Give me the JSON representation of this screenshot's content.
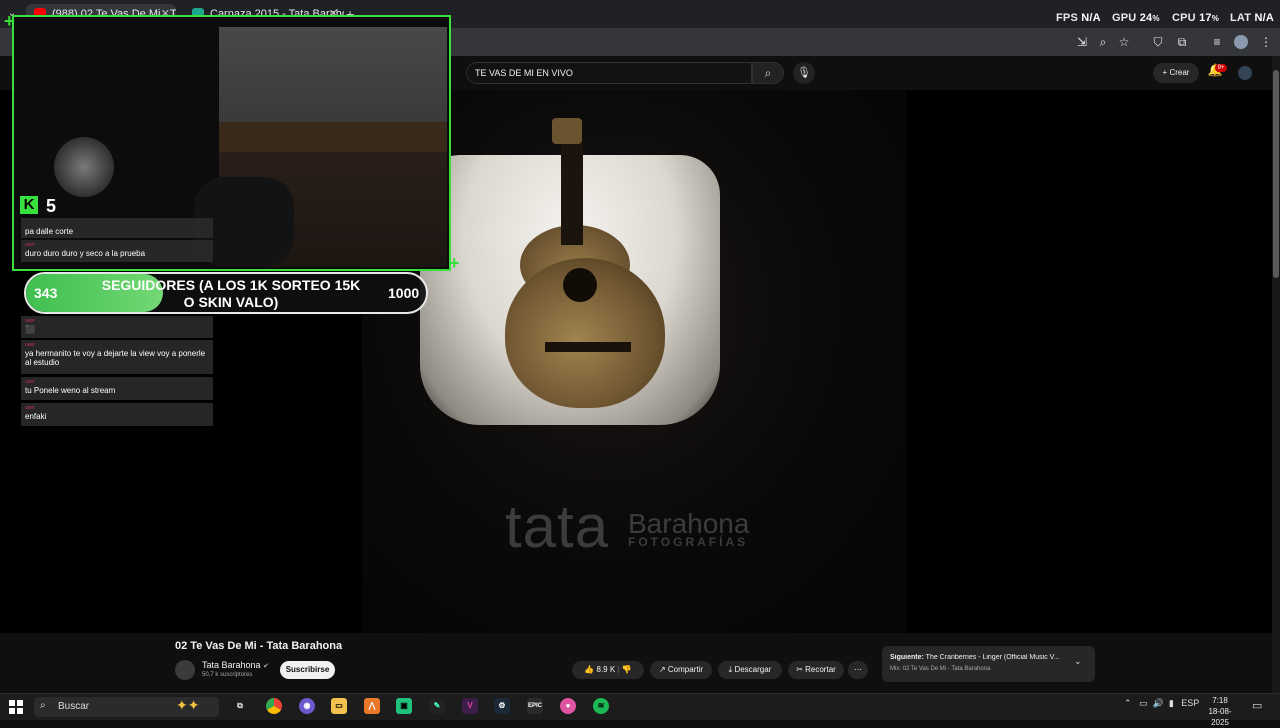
{
  "browser": {
    "tabs": [
      {
        "label": "(988) 02 Te Vas De Mi - Tat…",
        "favicon_color": "#ff0000"
      },
      {
        "label": "Carnaza 2015 - Tata Barahona",
        "favicon_color": "#1ca68c"
      }
    ],
    "new_tab": "+"
  },
  "overlay_stats": {
    "fps_label": "FPS",
    "fps_value": "N/A",
    "gpu_label": "GPU",
    "gpu_value": "24",
    "cpu_label": "CPU",
    "cpu_value": "17",
    "lat_label": "LAT",
    "lat_value": "N/A",
    "percent": "%"
  },
  "youtube": {
    "search_value": "TE VAS DE MI EN VIVO",
    "create_label": "Crear",
    "notif_badge": "9+",
    "video_title": "02 Te Vas De Mi - Tata Barahona",
    "channel_name": "Tata Barahona",
    "subscribers": "50,7 k suscriptores",
    "subscribe_label": "Suscribirse",
    "likes": "8.9 K",
    "share_label": "Compartir",
    "download_label": "Descargar",
    "clip_label": "Recortar",
    "next_prefix": "Siguiente:",
    "next_title": "The Cranberries - Linger (Official Music V...",
    "next_mix": "Mix: 02 Te Vas De Mi - Tata Barahona",
    "watermark_main": "tata",
    "watermark_name": "Barahona",
    "watermark_sub": "FOTOGRAFÍAS"
  },
  "stream_overlay": {
    "kick_count": "5",
    "chat": [
      {
        "user": "user",
        "text": "pa dalle corte"
      },
      {
        "user": "user",
        "text": "duro duro duro y seco a la prueba"
      },
      {
        "user": "user",
        "text": "⬛"
      },
      {
        "user": "user",
        "text": "ya hermanito te voy a dejarte la view voy a ponerle al estudio"
      },
      {
        "user": "user",
        "text": "tu Ponele weno al stream"
      },
      {
        "user": "user",
        "text": "enfaki"
      }
    ],
    "goal": {
      "current": "343",
      "text": "SEGUIDORES (A LOS 1K SORTEO 15K O SKIN VALO)",
      "target": "1000",
      "progress": 0.343
    }
  },
  "taskbar": {
    "search_placeholder": "Buscar",
    "language": "ESP",
    "time": "7:18",
    "date": "18-08-2025"
  }
}
